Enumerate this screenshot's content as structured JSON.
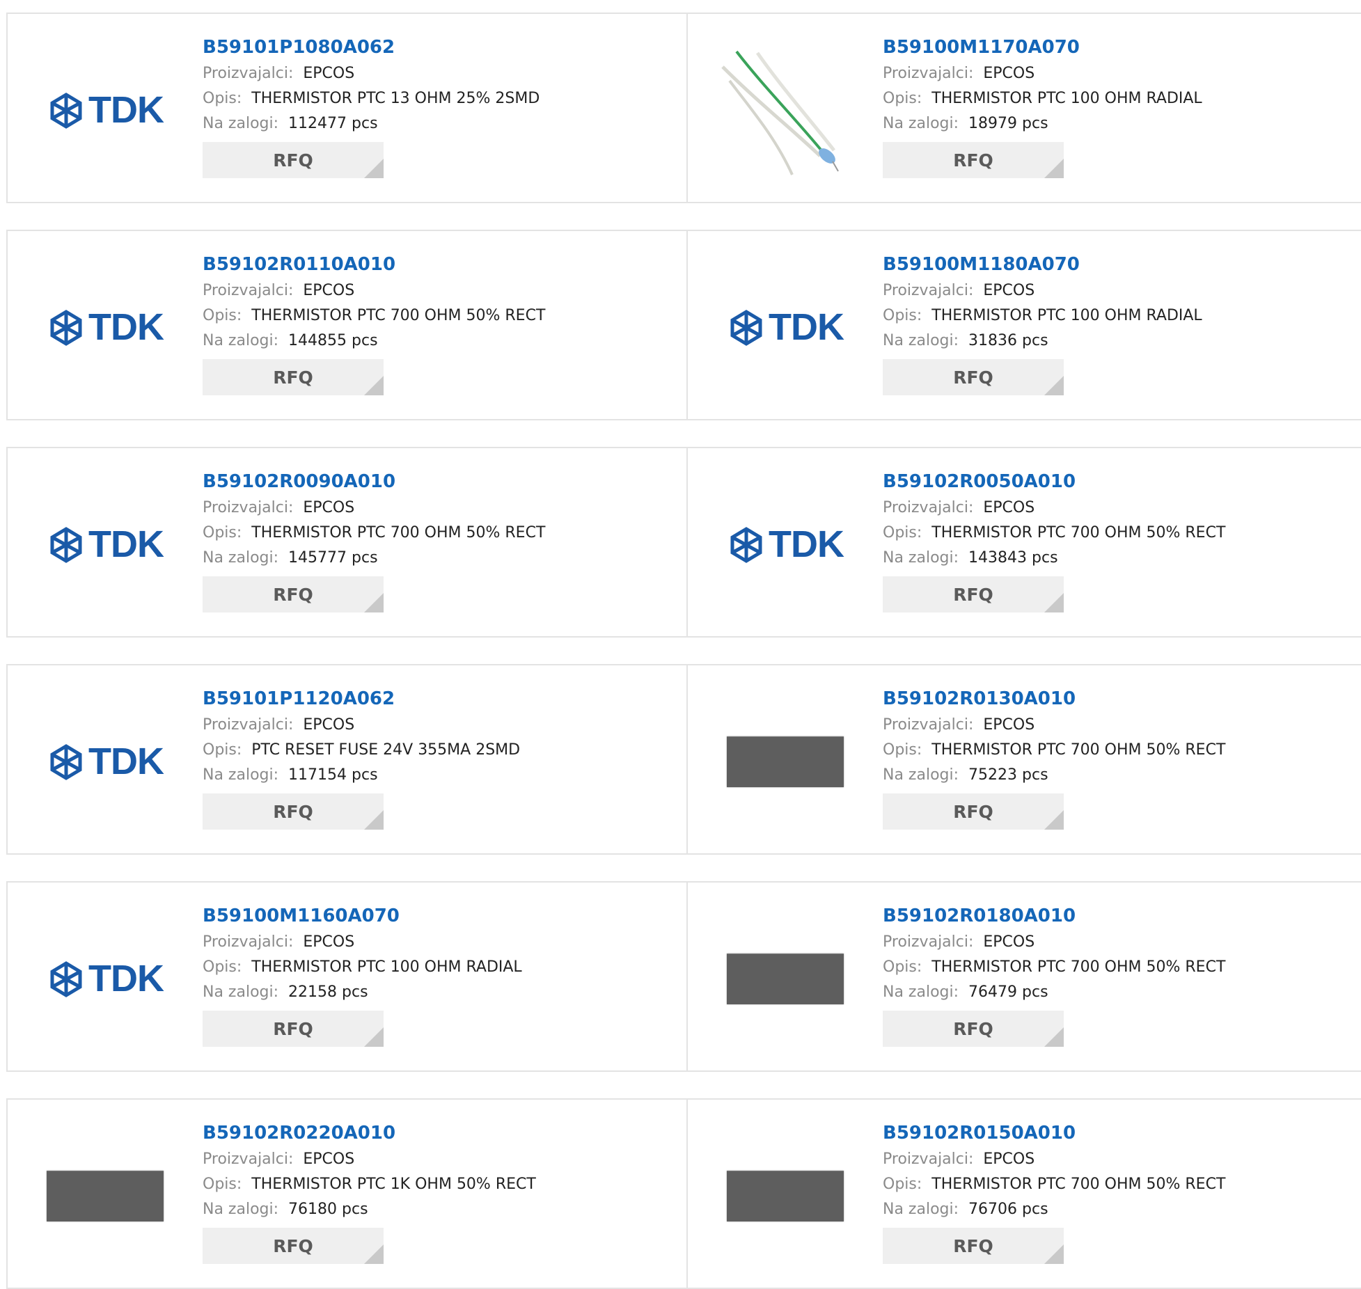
{
  "labels": {
    "manufacturer": "Proizvajalci:",
    "description": "Opis:",
    "stock": "Na zalogi:",
    "rfq": "RFQ",
    "logo_text": "TDK"
  },
  "colors": {
    "part_number": "#1466b8",
    "label": "#8a8a8a",
    "rfq_bg": "#efefef",
    "logo": "#1a5aa8"
  },
  "products": [
    {
      "part_number": "B59101P1080A062",
      "manufacturer": "EPCOS",
      "description": "THERMISTOR PTC 13 OHM 25% 2SMD",
      "stock": "112477 pcs",
      "image": "tdk-logo"
    },
    {
      "part_number": "B59100M1170A070",
      "manufacturer": "EPCOS",
      "description": "THERMISTOR PTC 100 OHM RADIAL",
      "stock": "18979 pcs",
      "image": "wire-thermistor-photo"
    },
    {
      "part_number": "B59102R0110A010",
      "manufacturer": "EPCOS",
      "description": "THERMISTOR PTC 700 OHM 50% RECT",
      "stock": "144855 pcs",
      "image": "tdk-logo"
    },
    {
      "part_number": "B59100M1180A070",
      "manufacturer": "EPCOS",
      "description": "THERMISTOR PTC 100 OHM RADIAL",
      "stock": "31836 pcs",
      "image": "tdk-logo"
    },
    {
      "part_number": "B59102R0090A010",
      "manufacturer": "EPCOS",
      "description": "THERMISTOR PTC 700 OHM 50% RECT",
      "stock": "145777 pcs",
      "image": "tdk-logo"
    },
    {
      "part_number": "B59102R0050A010",
      "manufacturer": "EPCOS",
      "description": "THERMISTOR PTC 700 OHM 50% RECT",
      "stock": "143843 pcs",
      "image": "tdk-logo"
    },
    {
      "part_number": "B59101P1120A062",
      "manufacturer": "EPCOS",
      "description": "PTC RESET FUSE 24V 355MA 2SMD",
      "stock": "117154 pcs",
      "image": "tdk-logo"
    },
    {
      "part_number": "B59102R0130A010",
      "manufacturer": "EPCOS",
      "description": "THERMISTOR PTC 700 OHM 50% RECT",
      "stock": "75223 pcs",
      "image": "rect-chip-photo"
    },
    {
      "part_number": "B59100M1160A070",
      "manufacturer": "EPCOS",
      "description": "THERMISTOR PTC 100 OHM RADIAL",
      "stock": "22158 pcs",
      "image": "tdk-logo"
    },
    {
      "part_number": "B59102R0180A010",
      "manufacturer": "EPCOS",
      "description": "THERMISTOR PTC 700 OHM 50% RECT",
      "stock": "76479 pcs",
      "image": "rect-chip-photo"
    },
    {
      "part_number": "B59102R0220A010",
      "manufacturer": "EPCOS",
      "description": "THERMISTOR PTC 1K OHM 50% RECT",
      "stock": "76180 pcs",
      "image": "rect-chip-photo"
    },
    {
      "part_number": "B59102R0150A010",
      "manufacturer": "EPCOS",
      "description": "THERMISTOR PTC 700 OHM 50% RECT",
      "stock": "76706 pcs",
      "image": "rect-chip-photo"
    }
  ]
}
